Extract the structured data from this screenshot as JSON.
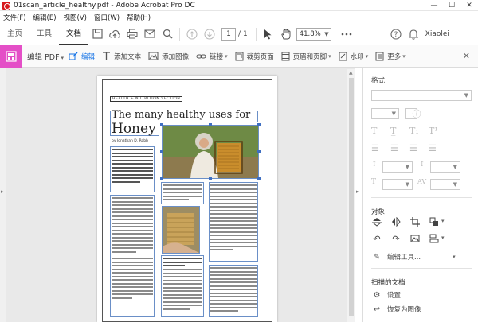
{
  "window": {
    "title": "01scan_article_healthy.pdf - Adobe Acrobat Pro DC",
    "controls": [
      "—",
      "☐",
      "✕"
    ]
  },
  "menu": [
    "文件(F)",
    "编辑(E)",
    "视图(V)",
    "窗口(W)",
    "帮助(H)"
  ],
  "tabs": {
    "home": "主页",
    "tools": "工具",
    "document": "文档"
  },
  "toolbar": {
    "page_current": "1",
    "page_total": "/ 1",
    "zoom": "41.8%",
    "user": "Xiaolei"
  },
  "editbar": {
    "title": "编辑 PDF",
    "tools": [
      {
        "label": "编辑",
        "icon": "edit-icon",
        "active": true
      },
      {
        "label": "添加文本",
        "icon": "add-text-icon"
      },
      {
        "label": "添加图像",
        "icon": "add-image-icon"
      },
      {
        "label": "链接",
        "icon": "link-icon",
        "dropdown": true
      },
      {
        "label": "裁剪页面",
        "icon": "crop-page-icon"
      },
      {
        "label": "页眉和页脚",
        "icon": "header-footer-icon",
        "dropdown": true
      },
      {
        "label": "水印",
        "icon": "watermark-icon",
        "dropdown": true
      },
      {
        "label": "更多",
        "icon": "more-icon",
        "dropdown": true
      }
    ]
  },
  "document": {
    "section_label": "HEALTH & NUTRITION SECTION",
    "headline": "The many healthy uses for",
    "headline_word": "Honey",
    "byline": "by Jonathan D. Robb"
  },
  "right_panel": {
    "format_header": "格式",
    "objects_header": "对象",
    "edit_tool_label": "编辑工具...",
    "scanned_header": "扫描的文档",
    "settings_label": "设置",
    "restore_label": "恢复为图像"
  },
  "colors": {
    "edit_pdf_accent": "#e44fc7",
    "active_tool": "#1473e6",
    "selection_box": "#6a8fc7"
  }
}
